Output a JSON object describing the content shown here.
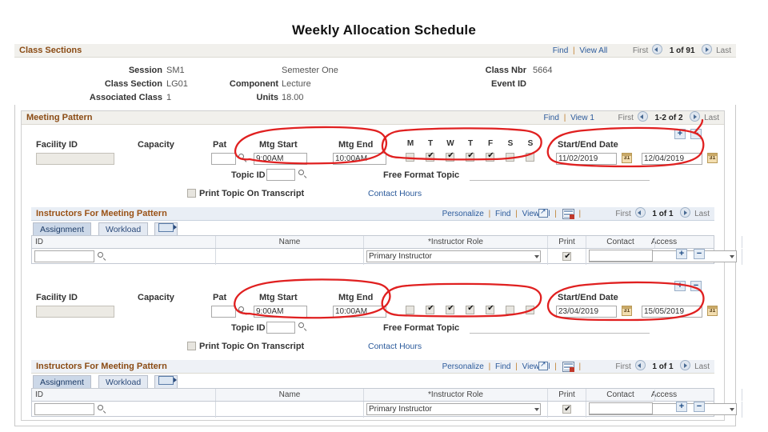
{
  "page": {
    "title": "Weekly Allocation Schedule",
    "accent": "#8a4b14",
    "link_color": "#2b5a9b",
    "ink_color": "#e02020"
  },
  "class_sections": {
    "header": "Class Sections",
    "links": {
      "find": "Find",
      "view_all": "View All",
      "first": "First",
      "count": "1 of 91",
      "last": "Last"
    },
    "fields": [
      {
        "label": "Session",
        "value": "SM1"
      },
      {
        "label": "Class Section",
        "value": "LG01"
      },
      {
        "label": "Associated Class",
        "value": "1"
      },
      {
        "label": "Component",
        "value": "Lecture"
      },
      {
        "label": "Units",
        "value": "18.00"
      },
      {
        "label": "Class Nbr",
        "value": "5664"
      },
      {
        "label": "Event ID",
        "value": ""
      }
    ],
    "session_desc": "Semester One"
  },
  "meeting_pattern": {
    "header": "Meeting Pattern",
    "links": {
      "find": "Find",
      "view_all": "View 1",
      "first": "First",
      "count": "1-2 of 2",
      "last": "Last"
    },
    "labels": {
      "facility_id": "Facility ID",
      "capacity": "Capacity",
      "pat": "Pat",
      "mtg_start": "Mtg Start",
      "mtg_end": "Mtg End",
      "start_end_date": "Start/End Date",
      "topic_id": "Topic ID",
      "free_format_topic": "Free Format Topic",
      "print_topic": "Print Topic On Transcript",
      "contact_hours": "Contact Hours"
    },
    "days": [
      "M",
      "T",
      "W",
      "T",
      "F",
      "S",
      "S"
    ],
    "add_button": "+",
    "remove_button": "−",
    "rows": [
      {
        "facility_id": "",
        "capacity": "",
        "pat": "",
        "mtg_start": "9:00AM",
        "mtg_end": "10:00AM",
        "days_checked": [
          false,
          true,
          true,
          true,
          true,
          false,
          false
        ],
        "start_date": "11/02/2019",
        "end_date": "12/04/2019",
        "topic_id": "",
        "free_format_topic": "",
        "print_topic_checked": false,
        "contact_hours": ""
      },
      {
        "facility_id": "",
        "capacity": "",
        "pat": "",
        "mtg_start": "9:00AM",
        "mtg_end": "10:00AM",
        "days_checked": [
          false,
          true,
          true,
          true,
          true,
          false,
          false
        ],
        "start_date": "23/04/2019",
        "end_date": "15/05/2019",
        "topic_id": "",
        "free_format_topic": "",
        "print_topic_checked": false,
        "contact_hours": ""
      }
    ]
  },
  "instructors": {
    "header": "Instructors For Meeting Pattern",
    "tabs": [
      {
        "label": "Assignment",
        "active": true
      },
      {
        "label": "Workload",
        "active": false
      },
      {
        "label": "",
        "active": false,
        "icon": "show-all-columns-icon"
      }
    ],
    "toolbar": {
      "personalize": "Personalize",
      "find": "Find",
      "view_all": "View All",
      "popup_icon": "new-window-icon",
      "download_icon": "download-grid-icon",
      "first": "First",
      "count": "1 of 1",
      "last": "Last"
    },
    "columns": [
      "ID",
      "Name",
      "*Instructor Role",
      "Print",
      "Access",
      "Contact"
    ],
    "rows": [
      {
        "id": "",
        "name": "",
        "instructor_role": "Primary Instructor",
        "print_checked": true,
        "access": "",
        "contact": "",
        "add_button": "+",
        "remove_button": "−"
      }
    ]
  },
  "annotations": {
    "label": "red-ink-circles",
    "regions": [
      "mtg-start-end-times-1",
      "days-of-week-1",
      "start-end-date-1",
      "mtg-start-end-times-2",
      "days-of-week-2",
      "start-end-date-2"
    ]
  }
}
